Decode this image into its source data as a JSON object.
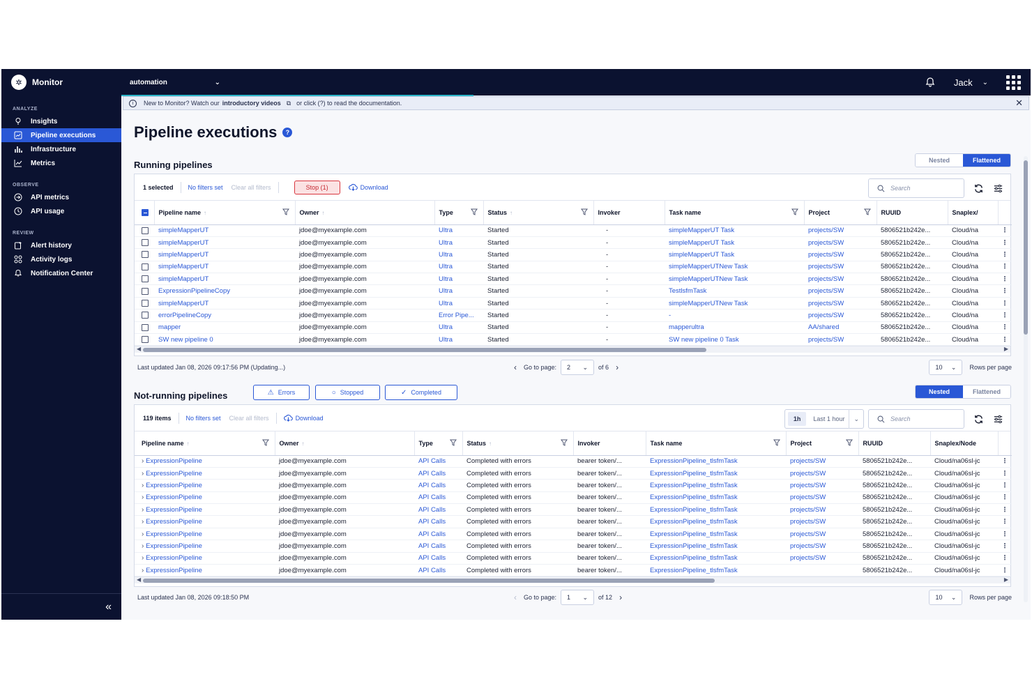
{
  "topbar": {
    "brand": "Monitor",
    "org": "automation",
    "user": "Jack"
  },
  "sidebar": {
    "sections": [
      {
        "title": "ANALYZE",
        "items": [
          {
            "label": "Insights",
            "icon": "bulb-icon"
          },
          {
            "label": "Pipeline executions",
            "icon": "pipeline-icon",
            "active": true
          },
          {
            "label": "Infrastructure",
            "icon": "bar-chart-icon"
          },
          {
            "label": "Metrics",
            "icon": "line-chart-icon"
          }
        ]
      },
      {
        "title": "OBSERVE",
        "items": [
          {
            "label": "API metrics",
            "icon": "api-icon"
          },
          {
            "label": "API usage",
            "icon": "clock-icon"
          }
        ]
      },
      {
        "title": "REVIEW",
        "items": [
          {
            "label": "Alert history",
            "icon": "alert-icon"
          },
          {
            "label": "Activity logs",
            "icon": "activity-icon"
          },
          {
            "label": "Notification Center",
            "icon": "bell-icon"
          }
        ]
      }
    ],
    "collapse_label": "«"
  },
  "banner": {
    "text1": "New to Monitor? Watch our",
    "bold": "introductory videos",
    "text2": "or click (?) to read the documentation."
  },
  "page": {
    "title": "Pipeline executions"
  },
  "running": {
    "title": "Running pipelines",
    "toggle": [
      "Nested",
      "Flattened"
    ],
    "toggle_active": "Flattened",
    "selected": "1 selected",
    "no_filters": "No filters set",
    "clear": "Clear all filters",
    "stop": "Stop (1)",
    "download": "Download",
    "search_placeholder": "Search",
    "columns": [
      "Pipeline name",
      "Owner",
      "Type",
      "Status",
      "Invoker",
      "Task name",
      "Project",
      "RUUID",
      "Snaplex/"
    ],
    "rows": [
      [
        "simpleMapperUT",
        "jdoe@myexample.com",
        "Ultra",
        "Started",
        "-",
        "simpleMapperUT Task",
        "projects/SW",
        "5806521b242e...",
        "Cloud/na"
      ],
      [
        "simpleMapperUT",
        "jdoe@myexample.com",
        "Ultra",
        "Started",
        "-",
        "simpleMapperUT Task",
        "projects/SW",
        "5806521b242e...",
        "Cloud/na"
      ],
      [
        "simpleMapperUT",
        "jdoe@myexample.com",
        "Ultra",
        "Started",
        "-",
        "simpleMapperUT Task",
        "projects/SW",
        "5806521b242e...",
        "Cloud/na"
      ],
      [
        "simpleMapperUT",
        "jdoe@myexample.com",
        "Ultra",
        "Started",
        "-",
        "simpleMapperUTNew Task",
        "projects/SW",
        "5806521b242e...",
        "Cloud/na"
      ],
      [
        "simpleMapperUT",
        "jdoe@myexample.com",
        "Ultra",
        "Started",
        "-",
        "simpleMapperUTNew Task",
        "projects/SW",
        "5806521b242e...",
        "Cloud/na"
      ],
      [
        "ExpressionPipelineCopy",
        "jdoe@myexample.com",
        "Ultra",
        "Started",
        "-",
        "TestlsfmTask",
        "projects/SW",
        "5806521b242e...",
        "Cloud/na"
      ],
      [
        "simpleMapperUT",
        "jdoe@myexample.com",
        "Ultra",
        "Started",
        "-",
        "simpleMapperUTNew Task",
        "projects/SW",
        "5806521b242e...",
        "Cloud/na"
      ],
      [
        "errorPipelineCopy",
        "jdoe@myexample.com",
        "Error Pipe...",
        "Started",
        "-",
        "-",
        "projects/SW",
        "5806521b242e...",
        "Cloud/na"
      ],
      [
        "mapper",
        "jdoe@myexample.com",
        "Ultra",
        "Started",
        "-",
        "mapperultra",
        "AA/shared",
        "5806521b242e...",
        "Cloud/na"
      ],
      [
        "SW new pipeline 0",
        "jdoe@myexample.com",
        "Ultra",
        "Started",
        "-",
        "SW new pipeline 0 Task",
        "projects/SW",
        "5806521b242e...",
        "Cloud/na"
      ]
    ],
    "last_updated": "Last updated Jan 08, 2026 09:17:56 PM (Updating...)",
    "go_to_page": "Go to page:",
    "page": "2",
    "of": "of 6",
    "rows_per_page_value": "10",
    "rows_per_page": "Rows per page"
  },
  "notrunning": {
    "title": "Not-running pipelines",
    "filters": [
      "Errors",
      "Stopped",
      "Completed"
    ],
    "toggle": [
      "Nested",
      "Flattened"
    ],
    "toggle_active": "Nested",
    "items": "119 items",
    "no_filters": "No filters set",
    "clear": "Clear all filters",
    "download": "Download",
    "time_tag": "1h",
    "time_label": "Last 1 hour",
    "search_placeholder": "Search",
    "columns": [
      "Pipeline name",
      "Owner",
      "Type",
      "Status",
      "Invoker",
      "Task name",
      "Project",
      "RUUID",
      "Snaplex/Node"
    ],
    "rows": [
      [
        "ExpressionPipeline",
        "jdoe@myexample.com",
        "API Calls",
        "Completed with errors",
        "bearer token/...",
        "ExpressionPipeline_tlsfmTask",
        "projects/SW",
        "5806521b242e...",
        "Cloud/na06sl-jc"
      ],
      [
        "ExpressionPipeline",
        "jdoe@myexample.com",
        "API Calls",
        "Completed with errors",
        "bearer token/...",
        "ExpressionPipeline_tlsfmTask",
        "projects/SW",
        "5806521b242e...",
        "Cloud/na06sl-jc"
      ],
      [
        "ExpressionPipeline",
        "jdoe@myexample.com",
        "API Calls",
        "Completed with errors",
        "bearer token/...",
        "ExpressionPipeline_tlsfmTask",
        "projects/SW",
        "5806521b242e...",
        "Cloud/na06sl-jc"
      ],
      [
        "ExpressionPipeline",
        "jdoe@myexample.com",
        "API Calls",
        "Completed with errors",
        "bearer token/...",
        "ExpressionPipeline_tlsfmTask",
        "projects/SW",
        "5806521b242e...",
        "Cloud/na06sl-jc"
      ],
      [
        "ExpressionPipeline",
        "jdoe@myexample.com",
        "API Calls",
        "Completed with errors",
        "bearer token/...",
        "ExpressionPipeline_tlsfmTask",
        "projects/SW",
        "5806521b242e...",
        "Cloud/na06sl-jc"
      ],
      [
        "ExpressionPipeline",
        "jdoe@myexample.com",
        "API Calls",
        "Completed with errors",
        "bearer token/...",
        "ExpressionPipeline_tlsfmTask",
        "projects/SW",
        "5806521b242e...",
        "Cloud/na06sl-jc"
      ],
      [
        "ExpressionPipeline",
        "jdoe@myexample.com",
        "API Calls",
        "Completed with errors",
        "bearer token/...",
        "ExpressionPipeline_tlsfmTask",
        "projects/SW",
        "5806521b242e...",
        "Cloud/na06sl-jc"
      ],
      [
        "ExpressionPipeline",
        "jdoe@myexample.com",
        "API Calls",
        "Completed with errors",
        "bearer token/...",
        "ExpressionPipeline_tlsfmTask",
        "projects/SW",
        "5806521b242e...",
        "Cloud/na06sl-jc"
      ],
      [
        "ExpressionPipeline",
        "jdoe@myexample.com",
        "API Calls",
        "Completed with errors",
        "bearer token/...",
        "ExpressionPipeline_tlsfmTask",
        "projects/SW",
        "5806521b242e...",
        "Cloud/na06sl-jc"
      ],
      [
        "ExpressionPipeline",
        "jdoe@myexample.com",
        "API Calls",
        "Completed with errors",
        "bearer token/...",
        "ExpressionPipeline_tlsfmTask",
        "",
        "5806521b242e...",
        "Cloud/na06sl-jc"
      ]
    ],
    "last_updated": "Last updated Jan 08, 2026 09:18:50 PM",
    "go_to_page": "Go to page:",
    "page": "1",
    "of": "of 12",
    "rows_per_page_value": "10",
    "rows_per_page": "Rows per page"
  },
  "colors": {
    "nav_bg": "#0b1230",
    "accent": "#2a58d6",
    "stop_red": "#d9363e"
  }
}
